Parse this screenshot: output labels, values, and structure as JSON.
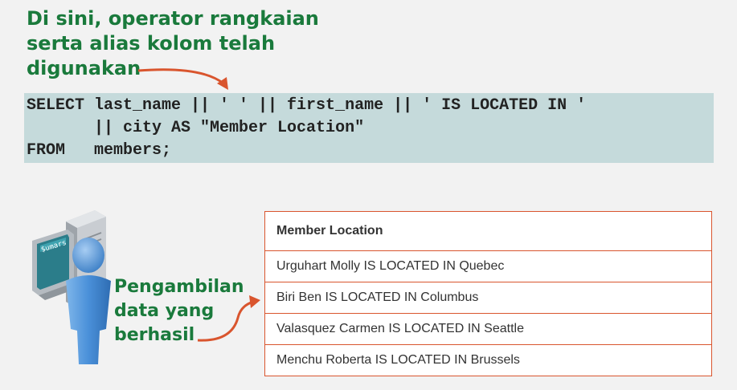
{
  "note_top": {
    "lines": [
      "Di sini, operator rangkaian",
      "serta alias kolom telah",
      "digunakan"
    ]
  },
  "code": {
    "lines": [
      "SELECT last_name || ' ' || first_name || ' IS LOCATED IN '",
      "       || city AS \"Member Location\"",
      "FROM   members;"
    ]
  },
  "note_bottom": {
    "lines": [
      "Pengambilan",
      "data yang",
      "berhasil"
    ]
  },
  "result_table": {
    "header": "Member Location",
    "rows": [
      "Urguhart Molly IS LOCATED IN Quebec",
      "Biri Ben IS LOCATED IN Columbus",
      "Valasquez Carmen IS LOCATED IN Seattle",
      "Menchu Roberta IS LOCATED IN Brussels"
    ]
  },
  "illustration": {
    "icon": "user-computer-icon",
    "screen_text": "$umars"
  },
  "colors": {
    "background": "#f2f2f2",
    "note_text": "#1a7a3c",
    "code_background": "#c5dadb",
    "arrow": "#d9552e",
    "table_border": "#d9552e",
    "figure_blue": "#4a90d9"
  }
}
